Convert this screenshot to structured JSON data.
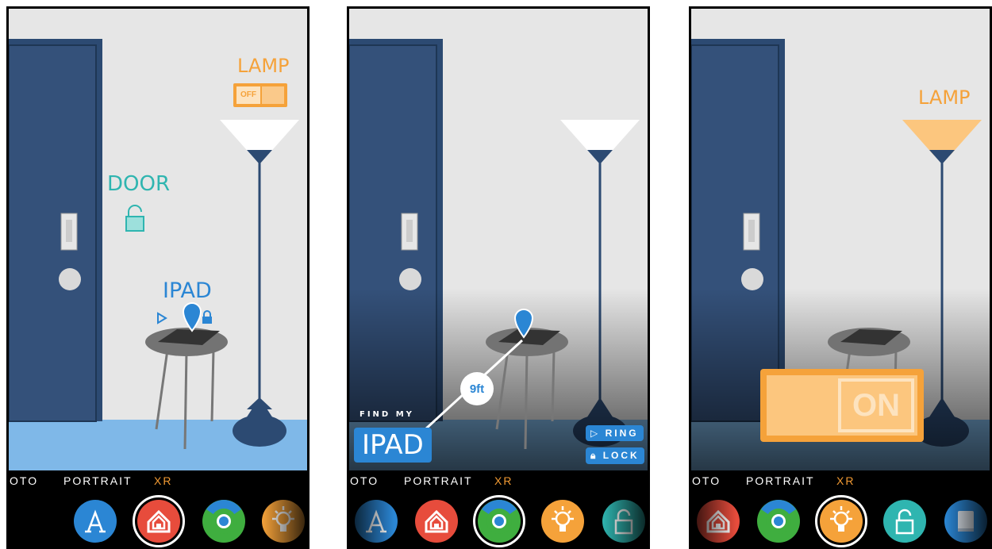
{
  "modes": {
    "photo_partial": "OTO",
    "portrait": "PORTRAIT",
    "xr": "XR"
  },
  "panel1": {
    "lamp_label": "LAMP",
    "lamp_toggle_text": "OFF",
    "door_label": "DOOR",
    "ipad_label": "IPAD"
  },
  "panel2": {
    "find_my": "FIND MY",
    "ipad_label": "IPAD",
    "distance": "9ft",
    "ring_label": "RING",
    "lock_label": "LOCK"
  },
  "panel3": {
    "lamp_label": "LAMP",
    "toggle_text": "ON"
  },
  "colors": {
    "wall": "#e6e6e6",
    "door": "#2c4a72",
    "floor_blue": "#7fb8e8",
    "accent_orange": "#f5a23a",
    "accent_blue": "#2b86d4",
    "accent_teal": "#2fb5b0",
    "mode_active": "#f29a33"
  },
  "dock_icons": {
    "panel1": [
      "app-store-icon",
      "home-icon",
      "find-my-icon",
      "lightbulb-icon"
    ],
    "panel2": [
      "app-store-icon",
      "home-icon",
      "find-my-icon",
      "lightbulb-icon",
      "unlock-icon"
    ],
    "panel3": [
      "home-icon",
      "find-my-icon",
      "lightbulb-icon",
      "unlock-icon",
      "book-icon"
    ]
  }
}
